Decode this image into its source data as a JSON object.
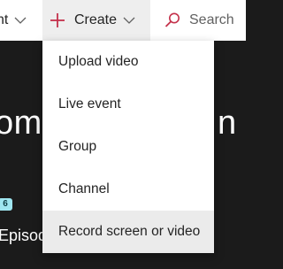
{
  "topbar": {
    "prev_label": "nt",
    "create_label": "Create",
    "search_label": "Search"
  },
  "background": {
    "title_left": "om",
    "title_right": "n",
    "badge": "6",
    "subtitle": "Episod"
  },
  "menu": {
    "items": [
      {
        "label": "Upload video"
      },
      {
        "label": "Live event"
      },
      {
        "label": "Group"
      },
      {
        "label": "Channel"
      },
      {
        "label": "Record screen or video"
      }
    ]
  },
  "colors": {
    "accent": "#c4314b",
    "topbar_bg": "#ffffff",
    "page_bg": "#1b1b1b"
  }
}
